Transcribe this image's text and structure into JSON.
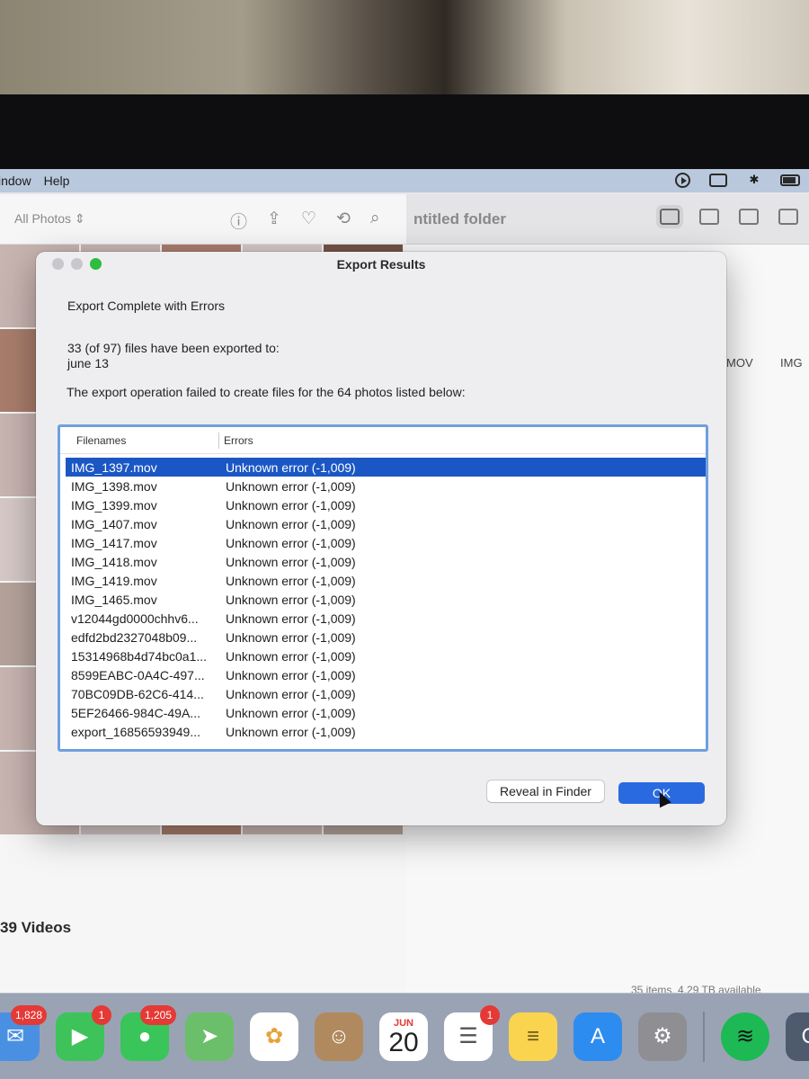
{
  "menubar": {
    "items": [
      "indow",
      "Help"
    ]
  },
  "photos_window": {
    "filter_label": "All Photos",
    "videos_count": "39 Videos"
  },
  "finder_window": {
    "title": "ntitled folder",
    "file_labels": [
      "MOV",
      "IMG"
    ],
    "status": "35 items, 4.29 TB available"
  },
  "dialog": {
    "title": "Export Results",
    "heading": "Export Complete with Errors",
    "summary_line1": "33 (of 97) files have been exported to:",
    "summary_line2": "june 13",
    "failed_message": "The export operation failed to create files for the 64 photos listed below:",
    "columns": [
      "Filenames",
      "Errors"
    ],
    "rows": [
      {
        "filename": "IMG_1397.mov",
        "error": "Unknown error (-1,009)",
        "selected": true
      },
      {
        "filename": "IMG_1398.mov",
        "error": "Unknown error (-1,009)"
      },
      {
        "filename": "IMG_1399.mov",
        "error": "Unknown error (-1,009)"
      },
      {
        "filename": "IMG_1407.mov",
        "error": "Unknown error (-1,009)"
      },
      {
        "filename": "IMG_1417.mov",
        "error": "Unknown error (-1,009)"
      },
      {
        "filename": "IMG_1418.mov",
        "error": "Unknown error (-1,009)"
      },
      {
        "filename": "IMG_1419.mov",
        "error": "Unknown error (-1,009)"
      },
      {
        "filename": "IMG_1465.mov",
        "error": "Unknown error (-1,009)"
      },
      {
        "filename": "v12044gd0000chhv6...",
        "error": "Unknown error (-1,009)"
      },
      {
        "filename": "edfd2bd2327048b09...",
        "error": "Unknown error (-1,009)"
      },
      {
        "filename": "15314968b4d74bc0a1...",
        "error": "Unknown error (-1,009)"
      },
      {
        "filename": "8599EABC-0A4C-497...",
        "error": "Unknown error (-1,009)"
      },
      {
        "filename": "70BC09DB-62C6-414...",
        "error": "Unknown error (-1,009)"
      },
      {
        "filename": "5EF26466-984C-49A...",
        "error": "Unknown error (-1,009)"
      },
      {
        "filename": "export_16856593949...",
        "error": "Unknown error (-1,009)"
      }
    ],
    "reveal_button": "Reveal in Finder",
    "ok_button": "OK"
  },
  "dock": {
    "mail_badge": "1,828",
    "facetime_badge": "1",
    "messages_badge": "1,205",
    "calendar_month": "JUN",
    "calendar_day": "20",
    "reminders_badge": "1"
  },
  "colors": {
    "selection": "#1b57c4",
    "ok_button": "#2a6ae0",
    "table_border": "#6f9fe0"
  }
}
